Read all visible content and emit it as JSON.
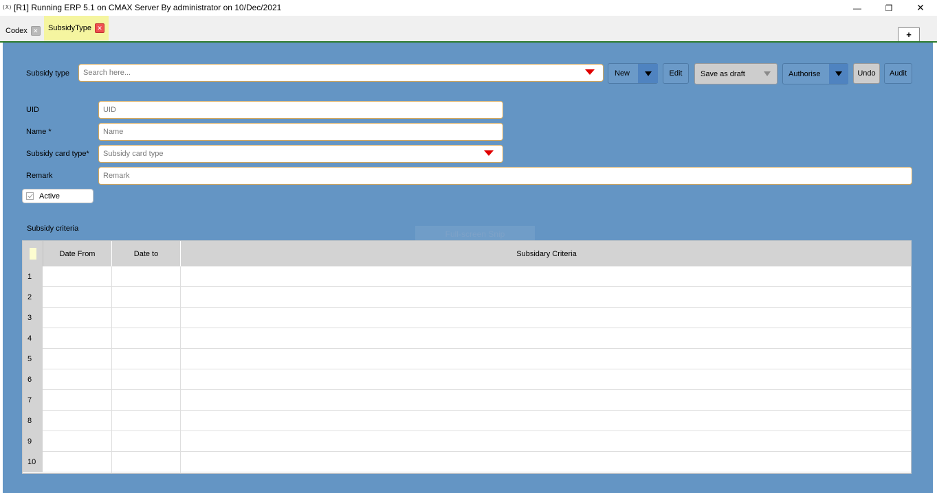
{
  "window": {
    "app_icon_text": "(X)",
    "title": "[R1] Running ERP 5.1 on CMAX Server By administrator on 10/Dec/2021",
    "minimize_symbol": "—",
    "maximize_symbol": "❐",
    "close_symbol": "✕"
  },
  "tabs": [
    {
      "label": "Codex",
      "close": "✕"
    },
    {
      "label": "SubsidyType",
      "close": "✕"
    }
  ],
  "new_tab_label": "+",
  "toolbar": {
    "subsidy_type_label": "Subsidy type",
    "search_placeholder": "Search here...",
    "new_label": "New",
    "edit_label": "Edit",
    "save_draft_label": "Save as draft",
    "authorise_label": "Authorise",
    "undo_label": "Undo",
    "audit_label": "Audit"
  },
  "form": {
    "uid_label": "UID",
    "uid_placeholder": "UID",
    "name_label": "Name *",
    "name_placeholder": "Name",
    "card_type_label": "Subsidy card type*",
    "card_type_placeholder": "Subsidy card type",
    "remark_label": "Remark",
    "remark_placeholder": "Remark",
    "active_label": "Active",
    "active_checked": true
  },
  "overlay_text": "Full-screen Snip",
  "criteria": {
    "section_label": "Subsidy criteria",
    "columns": [
      "Date From",
      "Date to",
      "Subsidary Criteria"
    ],
    "row_numbers": [
      "1",
      "2",
      "3",
      "4",
      "5",
      "6",
      "7",
      "8",
      "9",
      "10"
    ]
  },
  "colors": {
    "workspace": "#6495c4",
    "active_tab": "#f5f5a0",
    "dropdown_arrow": "#e00000",
    "tab_underline": "#2b7a2b"
  }
}
